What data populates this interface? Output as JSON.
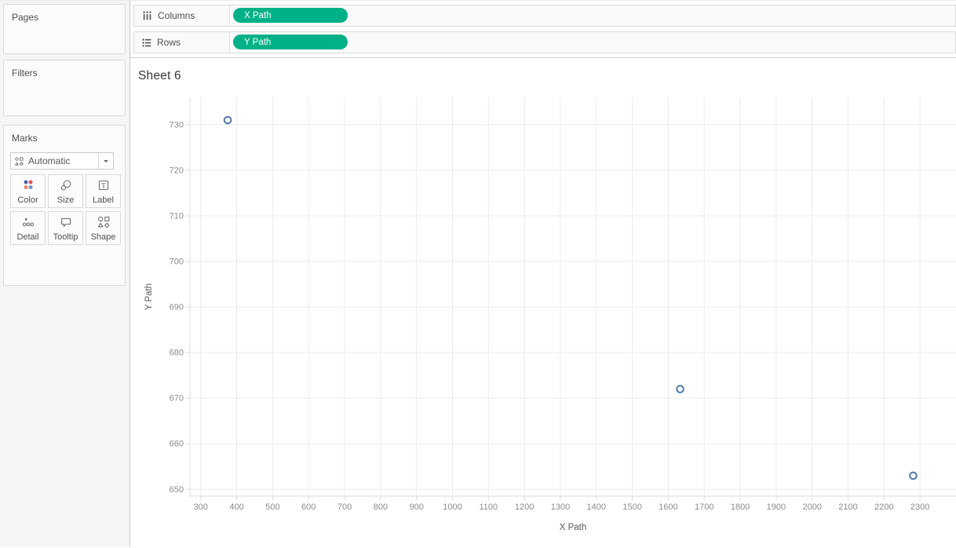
{
  "sidebar": {
    "pages_label": "Pages",
    "filters_label": "Filters",
    "marks_label": "Marks",
    "marks_card": {
      "type_selector": {
        "value": "Automatic",
        "icon": "marks-type-icon",
        "caret_icon": "caret-down-icon"
      },
      "label_icon_letter": "T",
      "buttons": [
        {
          "label": "Color",
          "icon": "color-icon"
        },
        {
          "label": "Size",
          "icon": "size-icon"
        },
        {
          "label": "Label",
          "icon": "label-icon"
        },
        {
          "label": "Detail",
          "icon": "detail-icon"
        },
        {
          "label": "Tooltip",
          "icon": "tooltip-icon"
        },
        {
          "label": "Shape",
          "icon": "shape-icon"
        }
      ]
    }
  },
  "shelves": {
    "columns": {
      "label": "Columns",
      "icon": "columns-icon",
      "pills": [
        {
          "text": "X Path",
          "type": "continuous"
        }
      ]
    },
    "rows": {
      "label": "Rows",
      "icon": "rows-icon",
      "pills": [
        {
          "text": "Y Path",
          "type": "continuous"
        }
      ]
    }
  },
  "sheet": {
    "title": "Sheet 6"
  },
  "colors": {
    "pill_green": "#00b087",
    "point_blue": "#4e79a7",
    "gridline": "#ececec",
    "axis_line": "#dcdcdc",
    "tick_label": "#8c8c8c",
    "axis_label": "#575757",
    "color_icon_dots": [
      "#5261a5",
      "#dd5257",
      "#ef8a62",
      "#6f93c3"
    ]
  },
  "chart_data": {
    "type": "scatter",
    "title": "Sheet 6",
    "xlabel": "X Path",
    "ylabel": "Y Path",
    "x_ticks": [
      300,
      400,
      500,
      600,
      700,
      800,
      900,
      1000,
      1100,
      1200,
      1300,
      1400,
      1500,
      1600,
      1700,
      1800,
      1900,
      2000,
      2100,
      2200,
      2300
    ],
    "y_ticks": [
      650,
      660,
      670,
      680,
      690,
      700,
      710,
      720,
      730
    ],
    "xlim": [
      270,
      2400
    ],
    "ylim": [
      648.5,
      736
    ],
    "grid": true,
    "legend": false,
    "marker": {
      "shape": "open-circle",
      "color": "#4e79a7",
      "radius_px": 4.3
    },
    "points": [
      {
        "x": 375,
        "y": 731
      },
      {
        "x": 1633,
        "y": 672
      },
      {
        "x": 2281,
        "y": 653
      }
    ]
  }
}
